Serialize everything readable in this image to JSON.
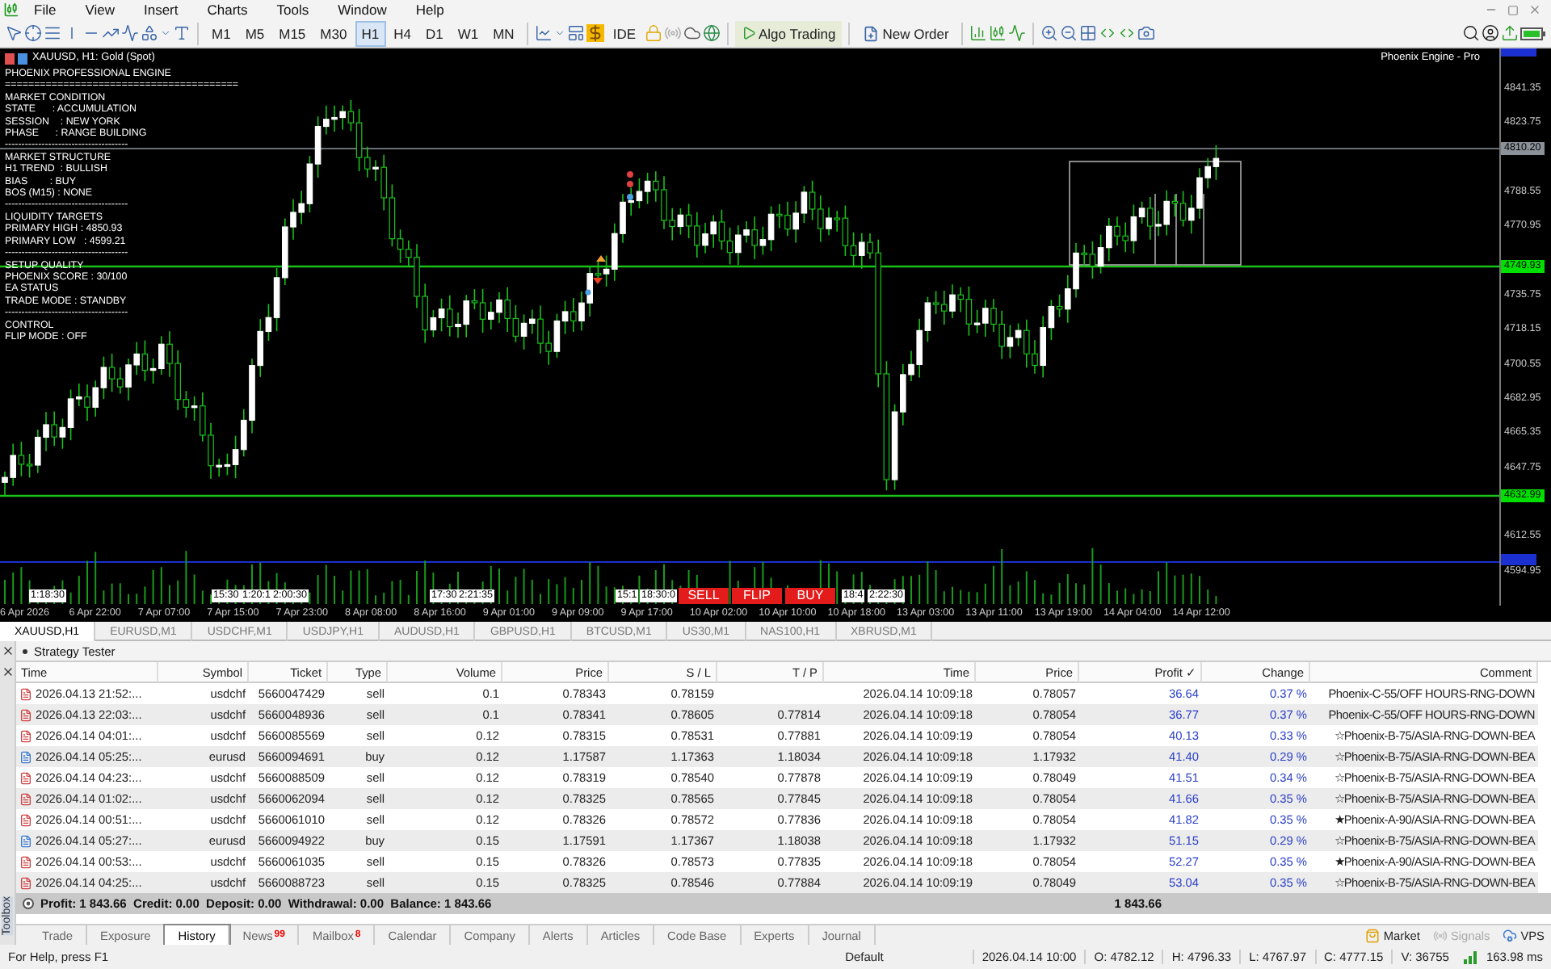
{
  "menu": [
    "File",
    "View",
    "Insert",
    "Charts",
    "Tools",
    "Window",
    "Help"
  ],
  "timeframes": [
    {
      "label": "M1",
      "selected": false
    },
    {
      "label": "M5",
      "selected": false
    },
    {
      "label": "M15",
      "selected": false
    },
    {
      "label": "M30",
      "selected": false
    },
    {
      "label": "H1",
      "selected": true
    },
    {
      "label": "H4",
      "selected": false
    },
    {
      "label": "D1",
      "selected": false
    },
    {
      "label": "W1",
      "selected": false
    },
    {
      "label": "MN",
      "selected": false
    }
  ],
  "toolbar": {
    "ide": "IDE",
    "algo_trading": "Algo Trading",
    "new_order": "New Order"
  },
  "chart": {
    "title": "XAUUSD, H1:  Gold (Spot)",
    "indicator": "Phoenix Engine - Pro",
    "panel": [
      "PHOENIX PROFESSIONAL ENGINE",
      "========================================",
      "MARKET CONDITION",
      "STATE      : ACCUMULATION",
      "SESSION    : NEW YORK",
      "PHASE      : RANGE BUILDING",
      "-------------------------------------",
      "MARKET STRUCTURE",
      "H1 TREND  : BULLISH",
      "BIAS        : BUY",
      "BOS (M15) : NONE",
      "-------------------------------------",
      "LIQUIDITY TARGETS",
      "PRIMARY HIGH : 4850.93",
      "PRIMARY LOW   : 4599.21",
      "-------------------------------------",
      "SETUP QUALITY",
      "PHOENIX SCORE : 30/100",
      "EA STATUS",
      "TRADE MODE : STANDBY",
      "-------------------------------------",
      "CONTROL",
      "FLIP MODE : OFF"
    ],
    "price_ticks": [
      "4841.35",
      "4823.75",
      "4788.55",
      "4770.95",
      "4735.75",
      "4718.15",
      "4700.55",
      "4682.95",
      "4665.35",
      "4647.75",
      "4612.55",
      "4594.95"
    ],
    "price_tags": [
      {
        "label": "4810.20",
        "color": "#8a9199"
      },
      {
        "label": "4749.93",
        "color": "#00e000"
      },
      {
        "label": "4632.99",
        "color": "#00e000"
      }
    ],
    "time_ticks": [
      "6 Apr 2026",
      "6 Apr 22:00",
      "7 Apr 07:00",
      "7 Apr 15:00",
      "7 Apr 23:00",
      "8 Apr 08:00",
      "8 Apr 16:00",
      "9 Apr 01:00",
      "9 Apr 09:00",
      "9 Apr 17:00",
      "10 Apr 02:00",
      "10 Apr 10:00",
      "10 Apr 18:00",
      "13 Apr 03:00",
      "13 Apr 11:00",
      "13 Apr 19:00",
      "14 Apr 04:00",
      "14 Apr 12:00"
    ],
    "time_markers": [
      "1:18:30",
      "15:30",
      "1:20:1",
      "2:00:30",
      "17:30",
      "2:21:35",
      "15:1",
      "18:30:0",
      "18:4",
      "2:22:30"
    ],
    "trade_buttons": [
      "SELL",
      "FLIP",
      "BUY"
    ]
  },
  "chart_tabs": [
    {
      "label": "XAUUSD,H1",
      "selected": true
    },
    {
      "label": "EURUSD,M1",
      "selected": false
    },
    {
      "label": "USDCHF,M1",
      "selected": false
    },
    {
      "label": "USDJPY,H1",
      "selected": false
    },
    {
      "label": "AUDUSD,H1",
      "selected": false
    },
    {
      "label": "GBPUSD,H1",
      "selected": false
    },
    {
      "label": "BTCUSD,M1",
      "selected": false
    },
    {
      "label": "US30,M1",
      "selected": false
    },
    {
      "label": "NAS100,H1",
      "selected": false
    },
    {
      "label": "XBRUSD,M1",
      "selected": false
    }
  ],
  "tester": {
    "title": "Strategy Tester",
    "columns": [
      "Time",
      "Symbol",
      "Ticket",
      "Type",
      "Volume",
      "Price",
      "S / L",
      "T / P",
      "Time",
      "Price",
      "Profit ✓",
      "Change",
      "Comment"
    ],
    "rows": [
      {
        "kind": "sell",
        "cells": [
          "2026.04.13 21:52:...",
          "usdchf",
          "5660047429",
          "sell",
          "0.1",
          "0.78343",
          "0.78159",
          "",
          "2026.04.14 10:09:18",
          "0.78057",
          "36.64",
          "0.37 %",
          "Phoenix-C-55/OFF HOURS-RNG-DOWN"
        ]
      },
      {
        "kind": "sell",
        "cells": [
          "2026.04.13 22:03:...",
          "usdchf",
          "5660048936",
          "sell",
          "0.1",
          "0.78341",
          "0.78605",
          "0.77814",
          "2026.04.14 10:09:18",
          "0.78054",
          "36.77",
          "0.37 %",
          "Phoenix-C-55/OFF HOURS-RNG-DOWN"
        ]
      },
      {
        "kind": "sell",
        "cells": [
          "2026.04.14 04:01:...",
          "usdchf",
          "5660085569",
          "sell",
          "0.12",
          "0.78315",
          "0.78531",
          "0.77881",
          "2026.04.14 10:09:19",
          "0.78054",
          "40.13",
          "0.33 %",
          "☆Phoenix-B-75/ASIA-RNG-DOWN-BEA"
        ]
      },
      {
        "kind": "buy",
        "cells": [
          "2026.04.14 05:25:...",
          "eurusd",
          "5660094691",
          "buy",
          "0.12",
          "1.17587",
          "1.17363",
          "1.18034",
          "2026.04.14 10:09:18",
          "1.17932",
          "41.40",
          "0.29 %",
          "☆Phoenix-B-75/ASIA-RNG-DOWN-BEA"
        ]
      },
      {
        "kind": "sell",
        "cells": [
          "2026.04.14 04:23:...",
          "usdchf",
          "5660088509",
          "sell",
          "0.12",
          "0.78319",
          "0.78540",
          "0.77878",
          "2026.04.14 10:09:19",
          "0.78049",
          "41.51",
          "0.34 %",
          "☆Phoenix-B-75/ASIA-RNG-DOWN-BEA"
        ]
      },
      {
        "kind": "sell",
        "cells": [
          "2026.04.14 01:02:...",
          "usdchf",
          "5660062094",
          "sell",
          "0.12",
          "0.78325",
          "0.78565",
          "0.77845",
          "2026.04.14 10:09:18",
          "0.78054",
          "41.66",
          "0.35 %",
          "☆Phoenix-B-75/ASIA-RNG-DOWN-BEA"
        ]
      },
      {
        "kind": "sell",
        "cells": [
          "2026.04.14 00:51:...",
          "usdchf",
          "5660061010",
          "sell",
          "0.12",
          "0.78326",
          "0.78572",
          "0.77836",
          "2026.04.14 10:09:18",
          "0.78054",
          "41.82",
          "0.35 %",
          "★Phoenix-A-90/ASIA-RNG-DOWN-BEA"
        ]
      },
      {
        "kind": "buy",
        "cells": [
          "2026.04.14 05:27:...",
          "eurusd",
          "5660094922",
          "buy",
          "0.15",
          "1.17591",
          "1.17367",
          "1.18038",
          "2026.04.14 10:09:18",
          "1.17932",
          "51.15",
          "0.29 %",
          "☆Phoenix-B-75/ASIA-RNG-DOWN-BEA"
        ]
      },
      {
        "kind": "sell",
        "cells": [
          "2026.04.14 00:53:...",
          "usdchf",
          "5660061035",
          "sell",
          "0.15",
          "0.78326",
          "0.78573",
          "0.77835",
          "2026.04.14 10:09:18",
          "0.78054",
          "52.27",
          "0.35 %",
          "★Phoenix-A-90/ASIA-RNG-DOWN-BEA"
        ]
      },
      {
        "kind": "sell",
        "cells": [
          "2026.04.14 04:25:...",
          "usdchf",
          "5660088723",
          "sell",
          "0.15",
          "0.78325",
          "0.78546",
          "0.77884",
          "2026.04.14 10:09:19",
          "0.78049",
          "53.04",
          "0.35 %",
          "☆Phoenix-B-75/ASIA-RNG-DOWN-BEA"
        ]
      }
    ],
    "summary": "Profit: 1 843.66  Credit: 0.00  Deposit: 0.00  Withdrawal: 0.00  Balance: 1 843.66",
    "summary_profit": "1 843.66"
  },
  "toolbox_label": "Toolbox",
  "bottom_tabs": [
    {
      "label": "Trade",
      "selected": false
    },
    {
      "label": "Exposure",
      "selected": false
    },
    {
      "label": "History",
      "selected": true
    },
    {
      "label": "News",
      "badge": "99",
      "selected": false
    },
    {
      "label": "Mailbox",
      "badge": "8",
      "selected": false
    },
    {
      "label": "Calendar",
      "selected": false
    },
    {
      "label": "Company",
      "selected": false
    },
    {
      "label": "Alerts",
      "selected": false
    },
    {
      "label": "Articles",
      "selected": false
    },
    {
      "label": "Code Base",
      "selected": false
    },
    {
      "label": "Experts",
      "selected": false
    },
    {
      "label": "Journal",
      "selected": false
    }
  ],
  "services": [
    {
      "label": "Market",
      "disabled": false,
      "kind": "market"
    },
    {
      "label": "Signals",
      "disabled": true,
      "kind": "signals"
    },
    {
      "label": "VPS",
      "disabled": false,
      "kind": "vps"
    }
  ],
  "status_bar": {
    "help": "For Help, press F1",
    "profile": "Default",
    "fields": [
      "2026.04.14 10:00",
      "O: 4782.12",
      "H: 4796.33",
      "L: 4767.97",
      "C: 4777.15",
      "V: 36755"
    ],
    "ping": "163.98 ms"
  }
}
